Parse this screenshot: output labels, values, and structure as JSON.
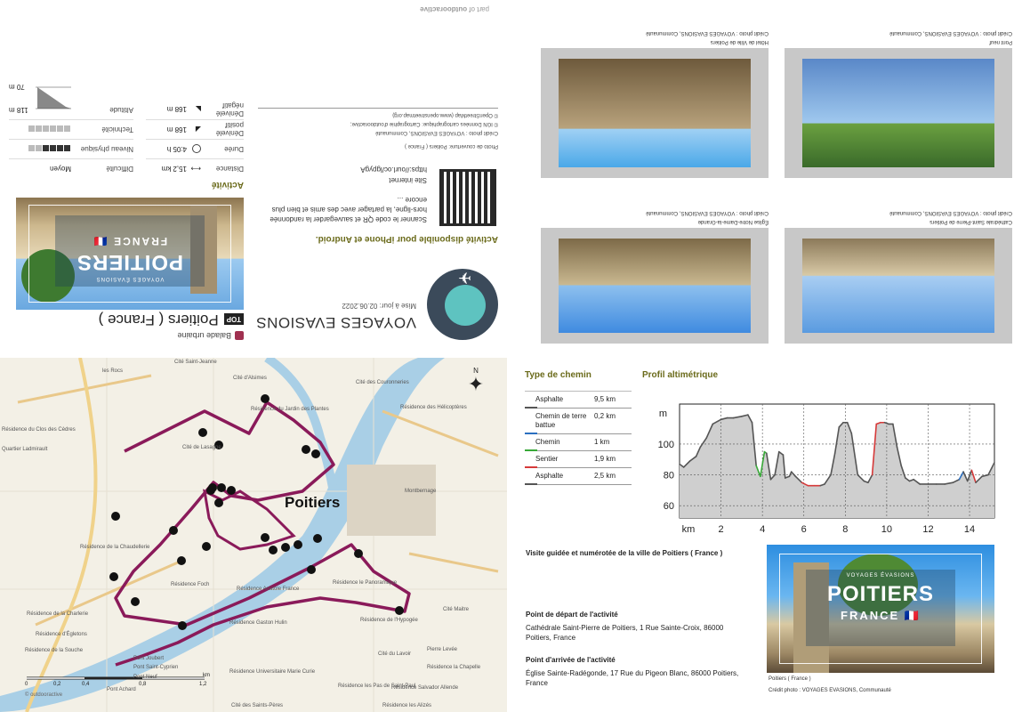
{
  "header": {
    "part_of_prefix": "part of",
    "part_of_brand": "outdooractive"
  },
  "activity": {
    "type": "Balade urbaine",
    "top_badge": "TOP",
    "title": "Poitiers ( France )"
  },
  "cover": {
    "title": "POITIERS",
    "subtitle": "FRANCE",
    "tagline": "VOYAGES ÉVASIONS",
    "flag": "🇫🇷"
  },
  "stats": {
    "heading": "Activité",
    "rows_left": [
      {
        "label": "Difficulté",
        "value": "Moyen"
      },
      {
        "label": "Niveau physique",
        "filled": 4,
        "total": 6
      },
      {
        "label": "Technicité",
        "filled": 0,
        "total": 6
      },
      {
        "label": "Altitude",
        "value_max": "118 m",
        "value_min": "70 m"
      }
    ],
    "rows_right": [
      {
        "label": "Distance",
        "value": "15,2 km"
      },
      {
        "label": "Durée",
        "value": "4:05 h"
      },
      {
        "label": "Dénivelé positif",
        "value": "168 m"
      },
      {
        "label": "Dénivelé négatif",
        "value": "168 m"
      }
    ]
  },
  "brand": {
    "name": "VOYAGES EVASIONS",
    "updated": "Mise à jour: 02.06.2022"
  },
  "app": {
    "heading": "Activité disponible pour iPhone et Android.",
    "text": "Scanner le code QR et sauvegarder la randonnée hors-ligne, la partager avec des amis et bien plus encore ...",
    "site_label": "Site internet",
    "site_url": "https://ourl.oc/lgpygA"
  },
  "credits": {
    "cover": "Photo de couverture: Poitiers ( France )",
    "photo": "Crédit photo : VOYAGES EVASIONS, Communauté",
    "ign": "© IGN Données cartographique: Cartographie d'outdooractive;",
    "osm": "© OpenStreetMap (www.openstreetmap.org)"
  },
  "photos": [
    {
      "caption": "Hôtel de Ville de Poitiers",
      "credit": "Crédit photo : VOYAGES EVASIONS, Communauté"
    },
    {
      "caption": "Pont neuf",
      "credit": "Crédit photo : VOYAGES EVASIONS, Communauté"
    },
    {
      "caption": "Église Notre-Dame-la-Grande",
      "credit": "Crédit photo : VOYAGES EVASIONS, Communauté"
    },
    {
      "caption": "Cathédrale Saint-Pierre de Poitiers",
      "credit": "Crédit photo : VOYAGES EVASIONS, Communauté"
    }
  ],
  "map": {
    "city": "Poitiers",
    "labels": [
      "les Rocs",
      "Cité Saint-Jeanne",
      "Cité d'Alsimes",
      "Résidence du Jardin des Plantes",
      "Cité des Couronneries",
      "Résidence des Hélicoptères",
      "Résidence du Clos des Cèdres",
      "Cité de Lasagne",
      "Quartier Ladmirault",
      "Résidence de la Chaudellerie",
      "Résidence Foch",
      "Résidence Anatole France",
      "Résidence le Panoramique",
      "Montbernage",
      "Résidence de la Charlerie",
      "Résidence Gaston Hulin",
      "Résidence de l'Hypogée",
      "Cité Maitre",
      "Résidence d'Égletons",
      "Résidence de la Souche",
      "Pont Joubert",
      "Pont Saint-Cyprien",
      "Pont Neuf",
      "Pierre Levée",
      "Résidence la Chapelle",
      "Pont Achard",
      "Résidence Universitaire Marie Curie",
      "Résidence les Pas de Saint-Paul",
      "Résidence les Alizés",
      "Cité des Saints-Pères",
      "Résidence Salvador Allende",
      "Cité du Lavoir"
    ],
    "scale": [
      "0",
      "0,2",
      "0,4",
      "0,8",
      "1,2",
      "km"
    ],
    "credit": "© outdooractive",
    "north": "N"
  },
  "path_types": {
    "heading": "Type de chemin",
    "items": [
      {
        "label": "Asphalte",
        "value": "9,5 km",
        "color": "#555555"
      },
      {
        "label": "Chemin de terre battue",
        "value": "0,2 km",
        "color": "#2b6fc0"
      },
      {
        "label": "Chemin",
        "value": "1 km",
        "color": "#38a838"
      },
      {
        "label": "Sentier",
        "value": "1,9 km",
        "color": "#d63a3a"
      },
      {
        "label": "Asphalte",
        "value": "2,5 km",
        "color": "#555555"
      }
    ]
  },
  "chart_data": {
    "type": "area",
    "title": "Profil altimétrique",
    "ylabel": "m",
    "xlabel": "km",
    "ylim": [
      52,
      126
    ],
    "xlim": [
      0,
      15.2
    ],
    "yticks": [
      60,
      80,
      100
    ],
    "xticks": [
      2,
      4,
      6,
      8,
      10,
      12,
      14
    ],
    "x": [
      0,
      0.2,
      0.5,
      0.8,
      1.0,
      1.3,
      1.6,
      2.0,
      2.3,
      2.6,
      3.0,
      3.3,
      3.5,
      3.7,
      3.9,
      4.1,
      4.2,
      4.4,
      4.6,
      4.8,
      5.0,
      5.1,
      5.3,
      5.4,
      5.6,
      5.9,
      6.2,
      6.5,
      6.8,
      7.0,
      7.3,
      7.5,
      7.7,
      7.9,
      8.1,
      8.3,
      8.6,
      8.9,
      9.1,
      9.3,
      9.5,
      9.7,
      9.9,
      10.1,
      10.3,
      10.5,
      10.7,
      10.9,
      11.1,
      11.3,
      11.6,
      12.0,
      12.4,
      12.8,
      13.2,
      13.5,
      13.7,
      13.9,
      14.1,
      14.3,
      14.6,
      14.9,
      15.2
    ],
    "y": [
      87,
      85,
      89,
      92,
      98,
      104,
      113,
      116,
      117,
      117,
      118,
      119,
      114,
      86,
      79,
      95,
      94,
      77,
      80,
      95,
      93,
      78,
      79,
      82,
      79,
      75,
      73,
      73,
      73,
      74,
      80,
      94,
      111,
      114,
      114,
      107,
      80,
      76,
      75,
      80,
      113,
      114,
      114,
      113,
      113,
      98,
      86,
      78,
      76,
      77,
      74,
      74,
      74,
      74,
      75,
      77,
      82,
      76,
      83,
      75,
      79,
      80,
      88
    ],
    "colors": [
      "#555",
      "#555",
      "#555",
      "#555",
      "#555",
      "#555",
      "#555",
      "#555",
      "#555",
      "#555",
      "#555",
      "#555",
      "#555",
      "#38a838",
      "#38a838",
      "#38a838",
      "#555",
      "#555",
      "#555",
      "#555",
      "#555",
      "#555",
      "#555",
      "#555",
      "#555",
      "#d63a3a",
      "#d63a3a",
      "#d63a3a",
      "#555",
      "#555",
      "#555",
      "#555",
      "#555",
      "#555",
      "#555",
      "#555",
      "#555",
      "#555",
      "#555",
      "#d63a3a",
      "#d63a3a",
      "#d63a3a",
      "#555",
      "#555",
      "#555",
      "#555",
      "#555",
      "#555",
      "#555",
      "#555",
      "#555",
      "#555",
      "#555",
      "#555",
      "#555",
      "#2b6fc0",
      "#555",
      "#555",
      "#d63a3a",
      "#555",
      "#555",
      "#555"
    ]
  },
  "tour": {
    "description": "Visite guidée et numérotée de la ville de Poitiers ( France )"
  },
  "start": {
    "heading": "Point de départ de l'activité",
    "text": "Cathédrale Saint-Pierre de Poitiers, 1 Rue Sainte-Croix, 86000 Poitiers, France"
  },
  "end": {
    "heading": "Point d'arrivée de l'activité",
    "text": "Église Sainte-Radégonde, 17 Rue du Pigeon Blanc, 86000 Poitiers, France"
  },
  "bottom_photo": {
    "caption": "Poitiers ( France )",
    "credit": "Crédit photo : VOYAGES EVASIONS, Communauté"
  }
}
